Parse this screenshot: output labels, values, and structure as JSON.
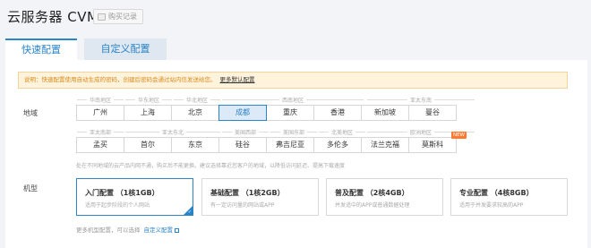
{
  "header": {
    "title": "云服务器 CVM",
    "purchase_button": "购买记录",
    "purchase_icon": "cart-icon"
  },
  "tabs": [
    {
      "label": "快速配置",
      "active": true
    },
    {
      "label": "自定义配置",
      "active": false
    }
  ],
  "notice": {
    "text": "说明：快速配置使用自动生成的密码，创建后密码会通过站内信发送给您。",
    "link": "更多默认配置"
  },
  "region": {
    "label": "地域",
    "row1_groups": [
      "华南地区",
      "华东地区",
      "华北地区",
      "西南地区",
      "亚太东南"
    ],
    "row1_cities": [
      "广州",
      "上海",
      "北京",
      "成都",
      "重庆",
      "香港",
      "新加坡",
      "曼谷"
    ],
    "row2_groups": [
      "亚太南部",
      "亚太东北",
      "美国西部",
      "美国东部",
      "北美地区",
      "欧洲地区"
    ],
    "row2_cities": [
      "孟买",
      "首尔",
      "东京",
      "硅谷",
      "弗吉尼亚",
      "多伦多",
      "法兰克福",
      "莫斯科"
    ],
    "selected_city": "成都",
    "new_badge": "NEW",
    "hint": "处在不同地域的云产品内网不通，购买后不能更换。建议选择靠近您客户的地域，以降低访问延迟、提高下载速度"
  },
  "machine": {
    "label": "机型",
    "options": [
      {
        "title": "入门配置 （1核1GB）",
        "desc": "适用于起步阶段的个人网站",
        "selected": true
      },
      {
        "title": "基础配置 （1核2GB）",
        "desc": "有一定访问量的网站或APP",
        "selected": false
      },
      {
        "title": "普及配置 （2核4GB）",
        "desc": "并发适中的APP或普通数据处理",
        "selected": false
      },
      {
        "title": "专业配置 （4核8GB）",
        "desc": "适用于并发要求较高的APP",
        "selected": false
      }
    ],
    "more_hint": "更多机型配置，可以选择",
    "more_link": "自定义配置"
  },
  "colors": {
    "accent": "#2a84c8",
    "notice_bg": "#fff3dc",
    "new_badge": "#ff7a2f"
  }
}
